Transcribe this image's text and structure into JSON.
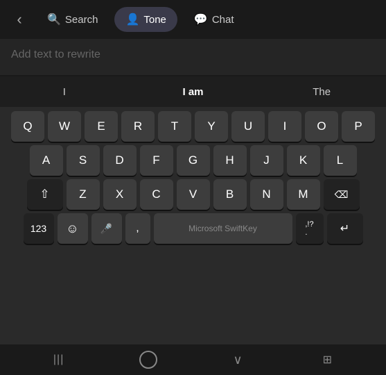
{
  "topbar": {
    "back_icon": "‹",
    "search_icon": "🔍",
    "search_label": "Search",
    "tone_icon": "👤",
    "tone_label": "Tone",
    "chat_icon": "💬",
    "chat_label": "Chat"
  },
  "input": {
    "placeholder": "Add text to rewrite"
  },
  "suggestions": [
    {
      "label": "I",
      "active": false
    },
    {
      "label": "I am",
      "active": true
    },
    {
      "label": "The",
      "active": false
    }
  ],
  "keyboard": {
    "rows": [
      [
        "Q",
        "W",
        "E",
        "R",
        "T",
        "Y",
        "U",
        "I",
        "O",
        "P"
      ],
      [
        "A",
        "S",
        "D",
        "F",
        "G",
        "H",
        "J",
        "K",
        "L"
      ],
      [
        "⇧",
        "Z",
        "X",
        "C",
        "V",
        "B",
        "N",
        "M",
        "⌫"
      ],
      [
        "123",
        "☺",
        "🎤",
        ",",
        "",
        "",
        ",!?",
        "↵"
      ]
    ],
    "space_label": "Microsoft SwiftKey"
  },
  "bottomnav": {
    "menu_icon": "|||",
    "home_icon": "○",
    "back_icon": "∨",
    "keyboard_icon": "⊞"
  }
}
